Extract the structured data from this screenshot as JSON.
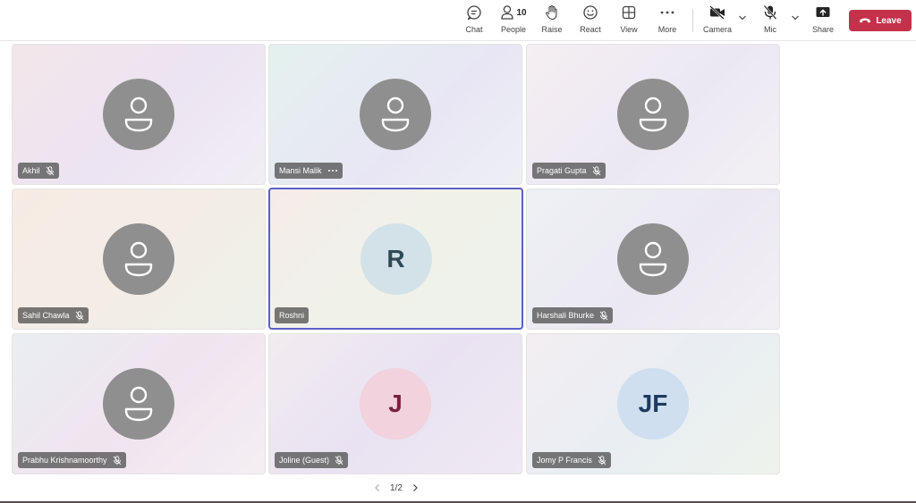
{
  "toolbar": {
    "chat": "Chat",
    "people": "People",
    "people_count": "10",
    "raise": "Raise",
    "react": "React",
    "view": "View",
    "more": "More",
    "camera": "Camera",
    "mic": "Mic",
    "share": "Share",
    "leave": "Leave"
  },
  "participants": [
    {
      "name": "Akhil",
      "initials": ""
    },
    {
      "name": "Mansi Malik",
      "initials": ""
    },
    {
      "name": "Pragati Gupta",
      "initials": ""
    },
    {
      "name": "Sahil Chawla",
      "initials": ""
    },
    {
      "name": "Roshni",
      "initials": "R"
    },
    {
      "name": "Harshali Bhurke",
      "initials": ""
    },
    {
      "name": "Prabhu Krishnamoorthy",
      "initials": ""
    },
    {
      "name": "Joline (Guest)",
      "initials": "J"
    },
    {
      "name": "Jomy P Francis",
      "initials": "JF"
    }
  ],
  "pager": {
    "label": "1/2"
  },
  "colors": {
    "leave_red": "#c4314b",
    "active_border": "#5b5fc7",
    "avatar_gray": "#8f8f8f"
  }
}
